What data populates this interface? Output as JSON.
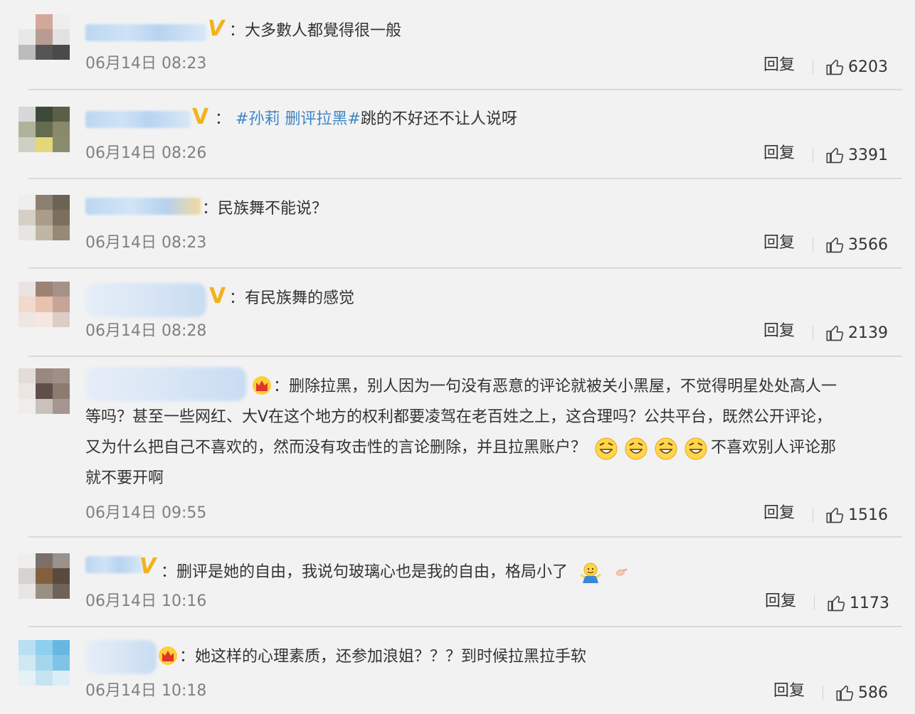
{
  "comments": [
    {
      "text": "：大多數人都覺得很一般",
      "time": "06月14日 08:23",
      "reply": "回复",
      "likes": "6203"
    },
    {
      "hashtag": "#孙莉 删评拉黑#",
      "colon": "：",
      "text": "跳的不好还不让人说呀",
      "time": "06月14日 08:26",
      "reply": "回复",
      "likes": "3391"
    },
    {
      "text": "：民族舞不能说？",
      "time": "06月14日 08:23",
      "reply": "回复",
      "likes": "3566"
    },
    {
      "text": "：有民族舞的感觉",
      "time": "06月14日 08:28",
      "reply": "回复",
      "likes": "2139"
    },
    {
      "text_line1": "：删除拉黑，别人因为一句没有恶意的评论就被关小黑屋，不觉得明星处处高人一",
      "text_line2": "等吗？甚至一些网红、大V在这个地方的权利都要凌驾在老百姓之上，这合理吗？公共平台，既然公开评论，",
      "text_line3a": "又为什么把自己不喜欢的，然而没有攻击性的言论删除，并且拉黑账户？",
      "text_line3b": "不喜欢别人评论那",
      "text_line4": "就不要开啊",
      "time": "06月14日 09:55",
      "reply": "回复",
      "likes": "1516"
    },
    {
      "text": "：删评是她的自由，我说句玻璃心也是我的自由，格局小了",
      "time": "06月14日 10:16",
      "reply": "回复",
      "likes": "1173"
    },
    {
      "text": "：她这样的心理素质，还参加浪姐？？？到时候拉黑拉手软",
      "time": "06月14日 10:18",
      "reply": "回复",
      "likes": "586"
    }
  ],
  "colors": {
    "background": "#f2f2f2",
    "text": "#333333",
    "time": "#808080",
    "hashtag": "#3d86c8",
    "vip": "#f2b21b",
    "divider": "#d9d9d9"
  },
  "icons": {
    "verified": "v-badge-icon",
    "crown": "crown-icon",
    "like": "thumbs-up-icon",
    "emoji": "grin-emoji-icon",
    "shrug": "shrug-emoji-icon"
  }
}
